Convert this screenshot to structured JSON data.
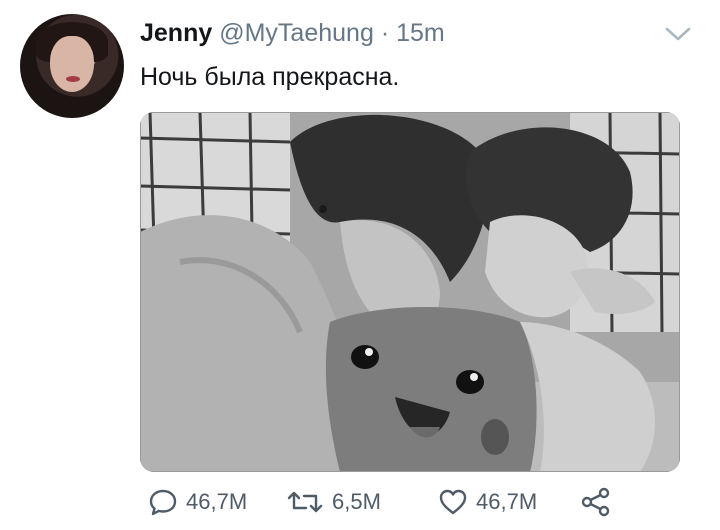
{
  "tweet": {
    "author_name": "Jenny",
    "handle": "@MyTaehung",
    "separator": "·",
    "time": "15m",
    "text": "Ночь была прекрасна."
  },
  "actions": {
    "replies": "46,7M",
    "retweets": "6,5M",
    "likes": "46,7M"
  },
  "icons": {
    "menu": "chevron-down-icon",
    "reply": "reply-icon",
    "retweet": "retweet-icon",
    "like": "heart-icon",
    "share": "share-icon"
  },
  "colors": {
    "text": "#14171a",
    "secondary": "#657786",
    "icon": "#4f5b66"
  }
}
